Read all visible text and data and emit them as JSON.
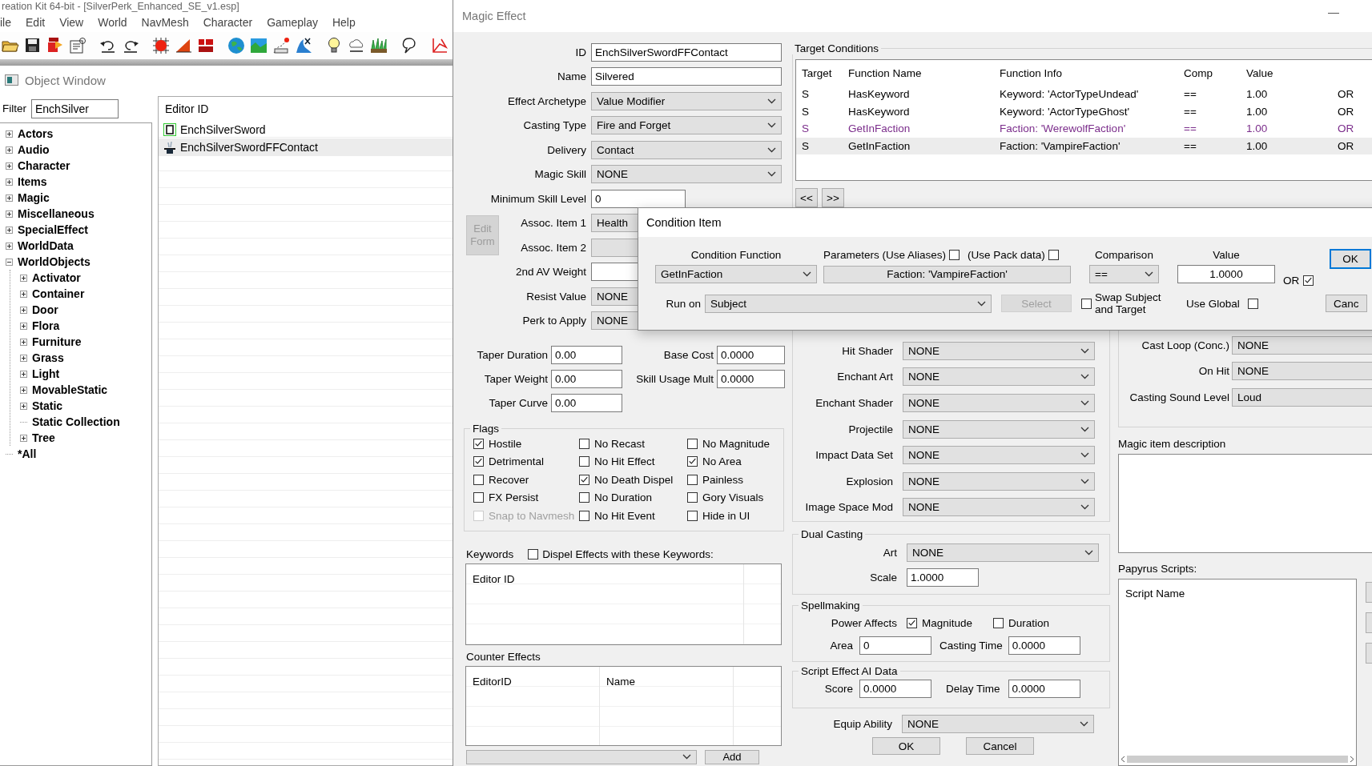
{
  "app": {
    "title": "reation Kit 64-bit - [SilverPerk_Enhanced_SE_v1.esp]",
    "menu": [
      "ile",
      "Edit",
      "View",
      "World",
      "NavMesh",
      "Character",
      "Gameplay",
      "Help"
    ]
  },
  "object_window": {
    "title": "Object Window",
    "filter": {
      "label": "Filter",
      "value": "EnchSilver"
    },
    "tree": [
      {
        "label": "Actors",
        "kind": "collapsed"
      },
      {
        "label": "Audio",
        "kind": "collapsed"
      },
      {
        "label": "Character",
        "kind": "collapsed"
      },
      {
        "label": "Items",
        "kind": "collapsed"
      },
      {
        "label": "Magic",
        "kind": "collapsed"
      },
      {
        "label": "Miscellaneous",
        "kind": "collapsed"
      },
      {
        "label": "SpecialEffect",
        "kind": "collapsed"
      },
      {
        "label": "WorldData",
        "kind": "collapsed"
      },
      {
        "label": "WorldObjects",
        "kind": "expanded",
        "children": [
          {
            "label": "Activator",
            "kind": "collapsed"
          },
          {
            "label": "Container",
            "kind": "collapsed"
          },
          {
            "label": "Door",
            "kind": "collapsed"
          },
          {
            "label": "Flora",
            "kind": "collapsed"
          },
          {
            "label": "Furniture",
            "kind": "collapsed"
          },
          {
            "label": "Grass",
            "kind": "collapsed"
          },
          {
            "label": "Light",
            "kind": "collapsed"
          },
          {
            "label": "MovableStatic",
            "kind": "collapsed"
          },
          {
            "label": "Static",
            "kind": "collapsed"
          },
          {
            "label": "Static Collection",
            "kind": "leaf"
          },
          {
            "label": "Tree",
            "kind": "collapsed"
          }
        ]
      },
      {
        "label": "*All",
        "kind": "leaf"
      }
    ],
    "list": {
      "columns": [
        "Editor ID"
      ],
      "rows": [
        {
          "editor_id": "EnchSilverSword",
          "kind": "enchantment",
          "selected": false
        },
        {
          "editor_id": "EnchSilverSwordFFContact",
          "kind": "magic_effect",
          "selected": true
        }
      ]
    }
  },
  "magic_effect": {
    "title": "Magic Effect",
    "fields": [
      {
        "label": "ID",
        "kind": "text",
        "value": "EnchSilverSwordFFContact"
      },
      {
        "label": "Name",
        "kind": "text",
        "value": "Silvered"
      },
      {
        "label": "Effect Archetype",
        "kind": "dropdown",
        "value": "Value Modifier"
      },
      {
        "label": "Casting Type",
        "kind": "dropdown",
        "value": "Fire and Forget"
      },
      {
        "label": "Delivery",
        "kind": "dropdown",
        "value": "Contact"
      },
      {
        "label": "Magic Skill",
        "kind": "dropdown",
        "value": "NONE"
      },
      {
        "label": "Minimum Skill Level",
        "kind": "short",
        "value": "0"
      },
      {
        "label": "Assoc. Item 1",
        "kind": "dropdown",
        "value": "Health"
      },
      {
        "label": "Assoc. Item 2",
        "kind": "dropdown"
      },
      {
        "label": "2nd AV Weight",
        "kind": "text"
      },
      {
        "label": "Resist Value",
        "kind": "dropdown",
        "value": "NONE"
      },
      {
        "label": "Perk to Apply",
        "kind": "dropdown",
        "value": "NONE"
      }
    ],
    "edit_form_button": {
      "label": "Edit Form",
      "disabled": true
    },
    "taper": [
      {
        "label": "Taper Duration",
        "value": "0.00"
      },
      {
        "label": "Taper Weight",
        "value": "0.00"
      },
      {
        "label": "Taper Curve",
        "value": "0.00"
      }
    ],
    "costs": [
      {
        "label": "Base Cost",
        "value": "0.0000"
      },
      {
        "label": "Skill Usage Mult",
        "value": "0.0000"
      }
    ],
    "flags": {
      "title": "Flags",
      "items": [
        {
          "label": "Hostile",
          "checked": true,
          "disabled": false
        },
        {
          "label": "Detrimental",
          "checked": true,
          "disabled": false
        },
        {
          "label": "Recover",
          "checked": false,
          "disabled": false
        },
        {
          "label": "FX Persist",
          "checked": false,
          "disabled": false
        },
        {
          "label": "Snap to Navmesh",
          "checked": false,
          "disabled": true
        },
        {
          "label": "No Recast",
          "checked": false,
          "disabled": false
        },
        {
          "label": "No Hit Effect",
          "checked": false,
          "disabled": false
        },
        {
          "label": "No Death Dispel",
          "checked": true,
          "disabled": false
        },
        {
          "label": "No Duration",
          "checked": false,
          "disabled": false
        },
        {
          "label": "No Hit Event",
          "checked": false,
          "disabled": false
        },
        {
          "label": "No Magnitude",
          "checked": false,
          "disabled": false
        },
        {
          "label": "No Area",
          "checked": true,
          "disabled": false
        },
        {
          "label": "Painless",
          "checked": false,
          "disabled": false
        },
        {
          "label": "Gory Visuals",
          "checked": false,
          "disabled": false
        },
        {
          "label": "Hide in UI",
          "checked": false,
          "disabled": false
        }
      ]
    },
    "keywords": {
      "label": "Keywords",
      "dispel": {
        "label": "Dispel Effects with these Keywords:",
        "checked": false
      },
      "columns": [
        "Editor ID"
      ]
    },
    "counter_effects": {
      "label": "Counter Effects",
      "columns": [
        "EditorID",
        "Name"
      ],
      "add_button": "Add"
    },
    "target_conditions": {
      "title": "Target Conditions",
      "columns": [
        "Target",
        "Function Name",
        "Function Info",
        "Comp",
        "Value"
      ],
      "rows": [
        {
          "target": "S",
          "function_name": "HasKeyword",
          "function_info": "Keyword: 'ActorTypeUndead'",
          "comp": "==",
          "value": "1.00",
          "column_6": "OR",
          "color": "#000000",
          "selected": false
        },
        {
          "target": "S",
          "function_name": "HasKeyword",
          "function_info": "Keyword: 'ActorTypeGhost'",
          "comp": "==",
          "value": "1.00",
          "column_6": "OR",
          "color": "#000000",
          "selected": false
        },
        {
          "target": "S",
          "function_name": "GetInFaction",
          "function_info": "Faction: 'WerewolfFaction'",
          "comp": "==",
          "value": "1.00",
          "column_6": "OR",
          "color": "#7b2d8b",
          "selected": false
        },
        {
          "target": "S",
          "function_name": "GetInFaction",
          "function_info": "Faction: 'VampireFaction'",
          "comp": "==",
          "value": "1.00",
          "column_6": "OR",
          "color": "#000000",
          "selected": true
        }
      ],
      "nav_buttons": [
        "<<",
        ">>"
      ]
    },
    "visuals": [
      {
        "label": "Hit Shader",
        "value": "NONE"
      },
      {
        "label": "Enchant Art",
        "value": "NONE"
      },
      {
        "label": "Enchant Shader",
        "value": "NONE"
      },
      {
        "label": "Projectile",
        "value": "NONE"
      },
      {
        "label": "Impact Data Set",
        "value": "NONE"
      },
      {
        "label": "Explosion",
        "value": "NONE"
      },
      {
        "label": "Image Space Mod",
        "value": "NONE"
      }
    ],
    "dual_casting": {
      "title": "Dual Casting",
      "art": {
        "label": "Art",
        "value": "NONE"
      },
      "scale": {
        "label": "Scale",
        "value": "1.0000"
      }
    },
    "spellmaking": {
      "title": "Spellmaking",
      "power_affects": {
        "label": "Power Affects",
        "options": [
          {
            "label": "Magnitude",
            "checked": true
          },
          {
            "label": "Duration",
            "checked": false
          }
        ]
      },
      "area": {
        "label": "Area",
        "value": "0"
      },
      "casting_time": {
        "label": "Casting Time",
        "value": "0.0000"
      }
    },
    "script_ai": {
      "title": "Script Effect AI Data",
      "score": {
        "label": "Score",
        "value": "0.0000"
      },
      "delay_time": {
        "label": "Delay Time",
        "value": "0.0000"
      }
    },
    "equip_ability": {
      "label": "Equip Ability",
      "value": "NONE"
    },
    "buttons": [
      "OK",
      "Cancel"
    ],
    "sounds": [
      {
        "label": "Cast Loop (Conc.)",
        "value": "NONE"
      },
      {
        "label": "On Hit",
        "value": "NONE"
      },
      {
        "label": "Casting Sound Level",
        "value": "Loud"
      }
    ],
    "description": {
      "label": "Magic item description"
    },
    "papyrus": {
      "label": "Papyrus Scripts:",
      "columns": [
        "Script Name"
      ]
    }
  },
  "condition_item": {
    "title": "Condition Item",
    "condition_function": {
      "label": "Condition Function",
      "value": "GetInFaction"
    },
    "use_aliases": {
      "label": "Parameters (Use Aliases)",
      "checked": false
    },
    "use_pack_data": {
      "label": "(Use Pack data)",
      "checked": false
    },
    "parameter": "Faction: 'VampireFaction'",
    "comparison": {
      "label": "Comparison",
      "value": "=="
    },
    "value": {
      "label": "Value",
      "value": "1.0000"
    },
    "or": {
      "label": "OR",
      "checked": true
    },
    "run_on": {
      "label": "Run on",
      "value": "Subject"
    },
    "select_button": {
      "label": "Select",
      "disabled": true
    },
    "swap": {
      "label": "Swap Subject and Target",
      "checked": false
    },
    "use_global": {
      "label": "Use Global",
      "checked": false
    },
    "buttons": [
      "OK",
      "Canc"
    ]
  }
}
